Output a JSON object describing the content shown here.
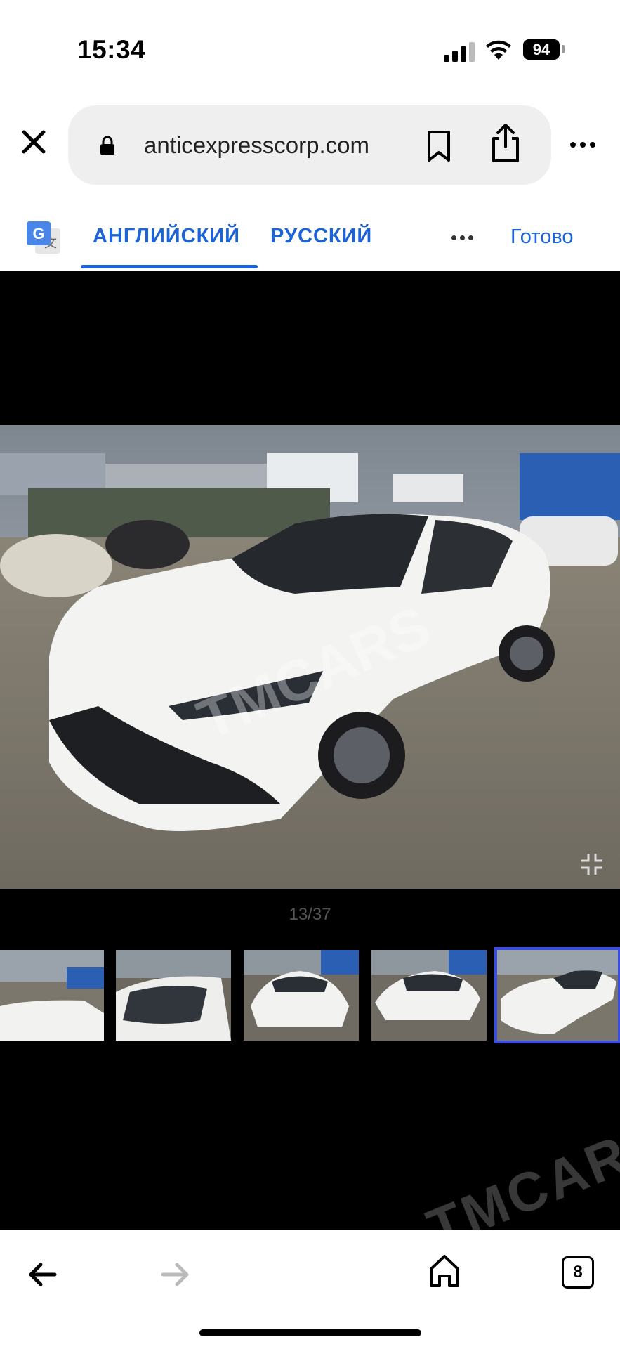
{
  "status": {
    "time": "15:34",
    "battery": "94"
  },
  "browser": {
    "url": "anticexpresscorp.com",
    "tabs_count": "8"
  },
  "translate": {
    "source_lang": "АНГЛИЙСКИЙ",
    "target_lang": "РУССКИЙ",
    "done": "Готово"
  },
  "gallery": {
    "counter": "13/37",
    "watermark": "TMCARS"
  },
  "colors": {
    "accent": "#1a63d8",
    "selected_thumb": "#3b4de0"
  },
  "icons": [
    "close-icon",
    "lock-icon",
    "bookmark-icon",
    "share-icon",
    "more-icon",
    "google-translate-icon",
    "collapse-icon",
    "back-arrow-icon",
    "forward-arrow-icon",
    "home-icon",
    "tabs-icon"
  ]
}
